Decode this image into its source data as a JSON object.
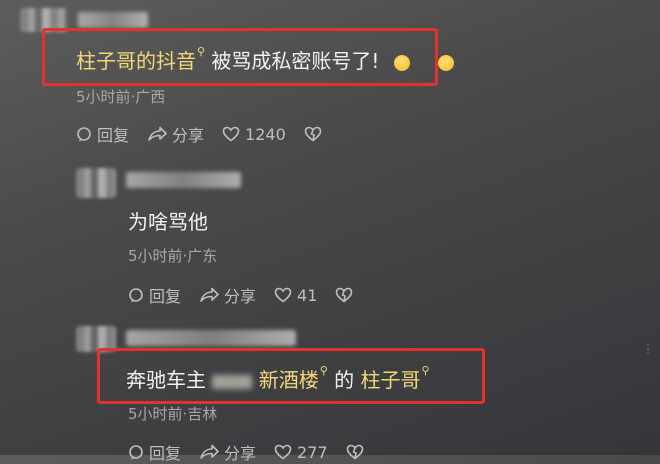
{
  "comments": [
    {
      "text_highlight": "柱子哥的抖音",
      "text_rest": "被骂成私密账号了!",
      "meta": "5小时前·广西",
      "reply_label": "回复",
      "share_label": "分享",
      "like_count": "1240"
    },
    {
      "text": "为啥骂他",
      "meta": "5小时前·广东",
      "reply_label": "回复",
      "share_label": "分享",
      "like_count": "41"
    },
    {
      "text_part1": "奔驰车主",
      "text_part2": "新酒楼",
      "text_part3": "的",
      "text_part4": "柱子哥",
      "meta": "5小时前·吉林",
      "reply_label": "回复",
      "share_label": "分享",
      "like_count": "277"
    }
  ],
  "colors": {
    "highlight_box": "#e2322c",
    "search_link": "#f4d878"
  }
}
